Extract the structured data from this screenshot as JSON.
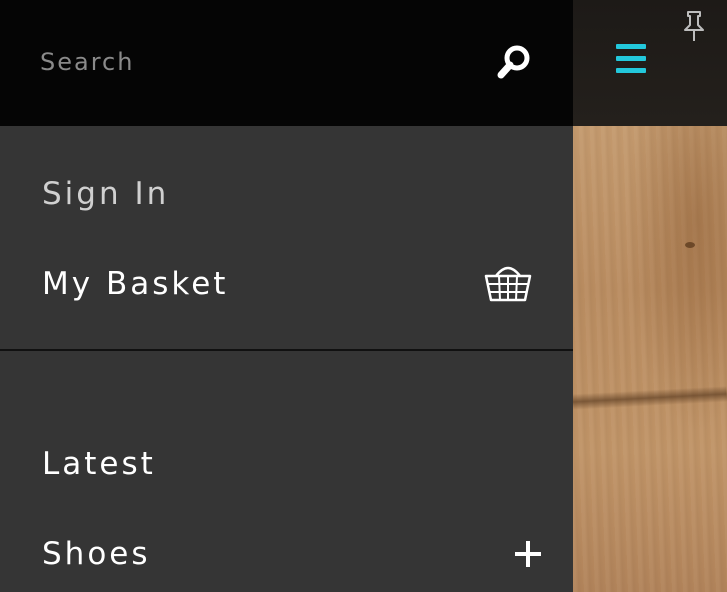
{
  "search": {
    "placeholder": "Search",
    "value": "",
    "icon": "search-icon"
  },
  "account_menu": {
    "sign_in_label": "Sign In",
    "basket_label": "My Basket",
    "basket_icon": "basket-icon"
  },
  "categories": [
    {
      "label": "Latest",
      "expandable": false
    },
    {
      "label": "Shoes",
      "expandable": true,
      "icon": "plus-icon"
    }
  ],
  "header": {
    "menu_icon": "hamburger-menu-icon",
    "pin_icon": "pin-icon"
  },
  "colors": {
    "accent": "#23c8dc",
    "drawer_background": "#353535",
    "search_background": "#050505",
    "text_primary": "#ffffff",
    "text_muted": "#d0d0d0"
  }
}
